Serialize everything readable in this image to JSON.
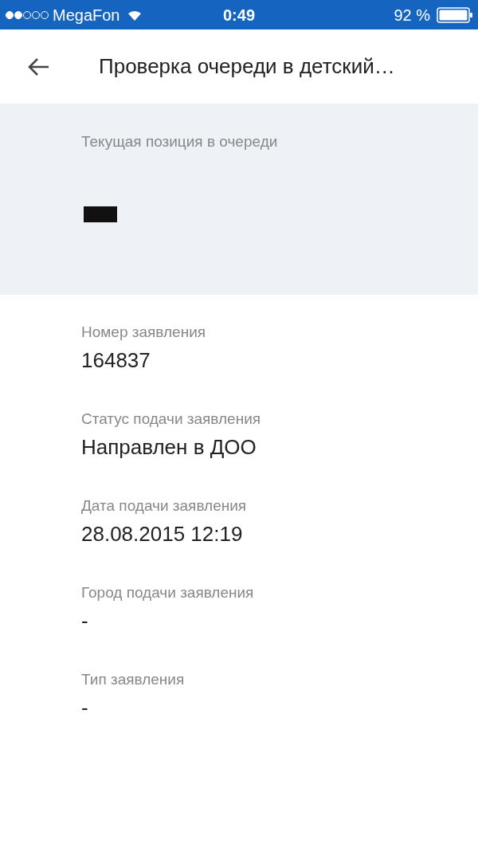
{
  "status_bar": {
    "carrier": "MegaFon",
    "time": "0:49",
    "battery": "92 %"
  },
  "header": {
    "title": "Проверка очереди в детский…"
  },
  "position": {
    "label": "Текущая позиция в очереди"
  },
  "fields": [
    {
      "label": "Номер заявления",
      "value": "164837"
    },
    {
      "label": "Статус подачи заявления",
      "value": "Направлен в ДОО"
    },
    {
      "label": "Дата подачи заявления",
      "value": "28.08.2015 12:19"
    },
    {
      "label": "Город подачи заявления",
      "value": "-"
    },
    {
      "label": "Тип заявления",
      "value": "-"
    }
  ]
}
